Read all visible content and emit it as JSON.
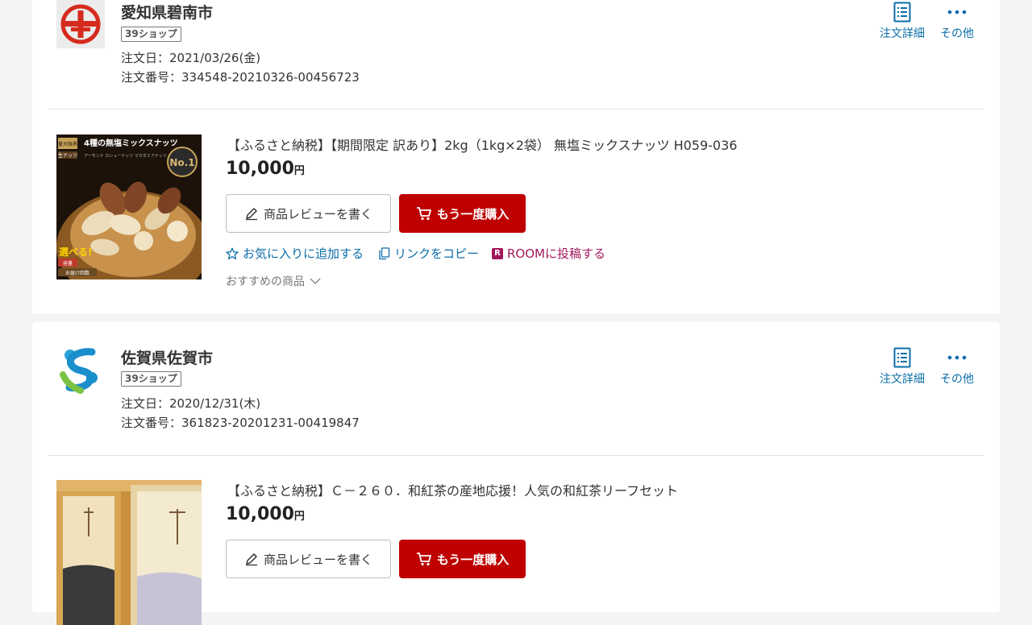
{
  "orders": [
    {
      "shop_name": "愛知県碧南市",
      "shop_badge": "39ショップ",
      "order_date": "注文日：2021/03/26(金)",
      "order_number": "注文番号：334548-20210326-00456723",
      "actions": {
        "detail": "注文詳細",
        "other": "その他"
      },
      "product": {
        "title": "【ふるさと納税】【期間限定 訳あり】2kg（1kg×2袋） 無塩ミックスナッツ H059-036",
        "price": "10,000",
        "currency": "円",
        "image_text": {
          "headline": "4種の無塩ミックスナッツ",
          "badge_top": "量大限界",
          "tag": "生ナッツ",
          "sub": "アーモンド カシューナッツ マカダミアナッツ くるみ",
          "rank": "No.1",
          "select": "選べる!",
          "capacity": "容量",
          "delivery": "お届け回数"
        }
      },
      "buttons": {
        "review": "商品レビューを書く",
        "rebuy": "もう一度購入"
      },
      "links": {
        "favorite": "お気に入りに追加する",
        "copy": "リンクをコピー",
        "room": "ROOMに投稿する"
      },
      "recommend": "おすすめの商品"
    },
    {
      "shop_name": "佐賀県佐賀市",
      "shop_badge": "39ショップ",
      "order_date": "注文日：2020/12/31(木)",
      "order_number": "注文番号：361823-20201231-00419847",
      "actions": {
        "detail": "注文詳細",
        "other": "その他"
      },
      "product": {
        "title": "【ふるさと納税】Ｃ－２６０．和紅茶の産地応援！人気の和紅茶リーフセット",
        "price": "10,000",
        "currency": "円"
      },
      "buttons": {
        "review": "商品レビューを書く",
        "rebuy": "もう一度購入"
      }
    }
  ],
  "icons": {
    "detail": "order-detail-icon",
    "other": "more-dots-icon",
    "review": "pencil-icon",
    "rebuy": "cart-icon",
    "favorite": "star-outline-icon",
    "copy": "copy-icon",
    "room": "room-logo-icon",
    "recommend": "chevron-down-icon"
  },
  "colors": {
    "accent_red": "#bf0000",
    "link_blue": "#0b6ea8",
    "room_pink": "#a3175b",
    "background": "#f4f4f4"
  }
}
